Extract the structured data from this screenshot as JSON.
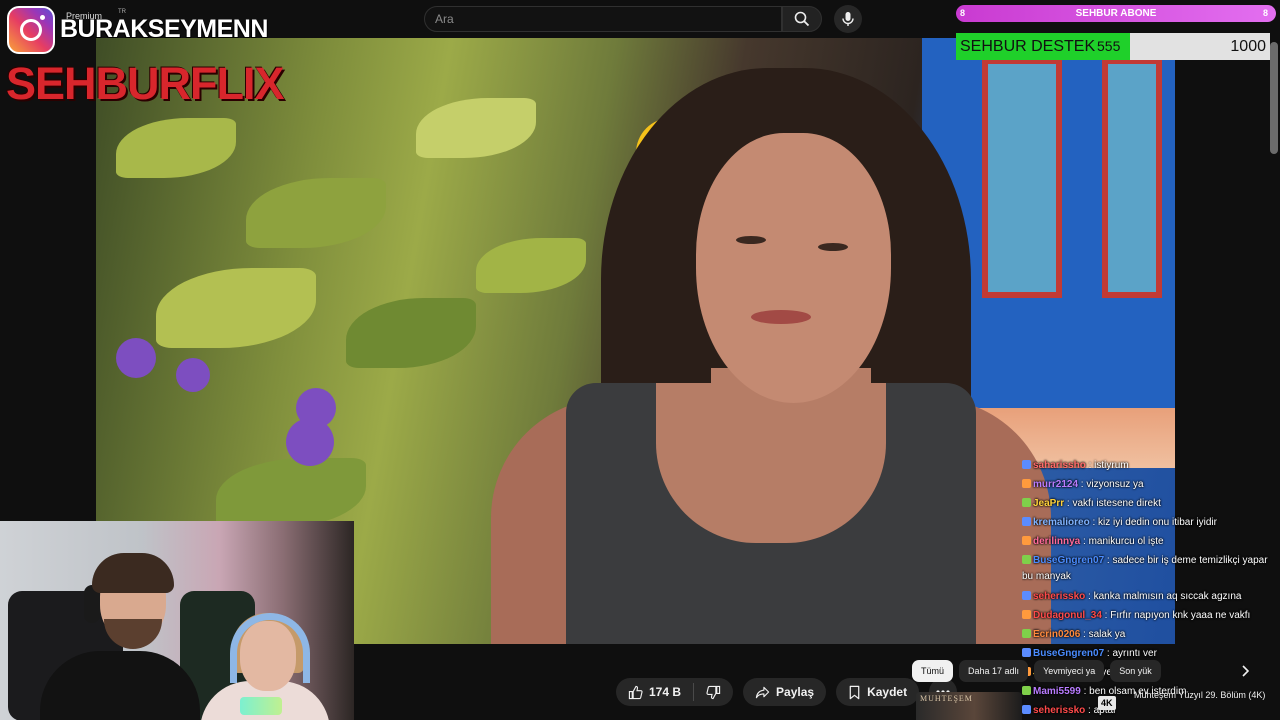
{
  "search": {
    "placeholder": "Ara"
  },
  "overlay": {
    "premium_label": "Premium",
    "premium_region": "TR",
    "instagram_handle": "BURAKSEYMENN",
    "brand_text": "SEHBURFLIX"
  },
  "alerts": {
    "subscriber_bar": {
      "label": "SEHBUR ABONE",
      "left_value": "8",
      "right_value": "8"
    },
    "support_goal": {
      "label": "SEHBUR DESTEK",
      "current": "555",
      "goal": "1000",
      "progress_fraction": 0.555
    }
  },
  "chat": {
    "messages": [
      {
        "user": "saharissho",
        "message": "istiyrum",
        "color": "#ff6a6a"
      },
      {
        "user": "murr2124",
        "message": "vizyonsuz ya",
        "color": "#b97cff"
      },
      {
        "user": "JeaPrr",
        "message": "vakfı istesene direkt",
        "color": "#ffd23b"
      },
      {
        "user": "kremalioreo",
        "message": "kiz iyi dedin onu itibar iyidir",
        "color": "#7fb2ff"
      },
      {
        "user": "derilinnya",
        "message": "manikurcu ol işte",
        "color": "#ff6a9a"
      },
      {
        "user": "BuseGngren07",
        "message": "sadece bir iş deme temizlikçi yapar bu manyak",
        "color": "#4a8cff"
      },
      {
        "user": "seherissko",
        "message": "kanka malmısın aq sıccak agzına",
        "color": "#ff4a4a"
      },
      {
        "user": "Dudagonul_34",
        "message": "Fırfır napıyon knk yaaa ne vakfı",
        "color": "#ff4a4a"
      },
      {
        "user": "Ecrin0206",
        "message": "salak ya",
        "color": "#ff8a3d"
      },
      {
        "user": "BuseGngren07",
        "message": "ayrıntı ver",
        "color": "#4a8cff"
      },
      {
        "user": "JumPh",
        "message": "Yevmiyeci ya",
        "color": "#ffd23b"
      },
      {
        "user": "Mami5599",
        "message": "ben olsam ev isterdim",
        "color": "#b97cff"
      },
      {
        "user": "seherissko",
        "message": "aptal",
        "color": "#ff4a4a"
      }
    ]
  },
  "actions": {
    "like_count": "174 B",
    "share_label": "Paylaş",
    "save_label": "Kaydet"
  },
  "filters": {
    "chips": [
      "Tümü",
      "Daha 17 adlı",
      "Yevmiyeci ya",
      "Son yük"
    ],
    "active_index": 0
  },
  "recommendation": {
    "thumb_text": "MUHTEŞEM",
    "badge": "4K",
    "title": "Muhteşem Yüzyıl 29. Bölüm (4K)"
  },
  "colors": {
    "brand_red": "#d8262c",
    "subscriber_bar": "#d94fe0",
    "support_fill": "#1fd02a",
    "background": "#0f0f0f"
  }
}
